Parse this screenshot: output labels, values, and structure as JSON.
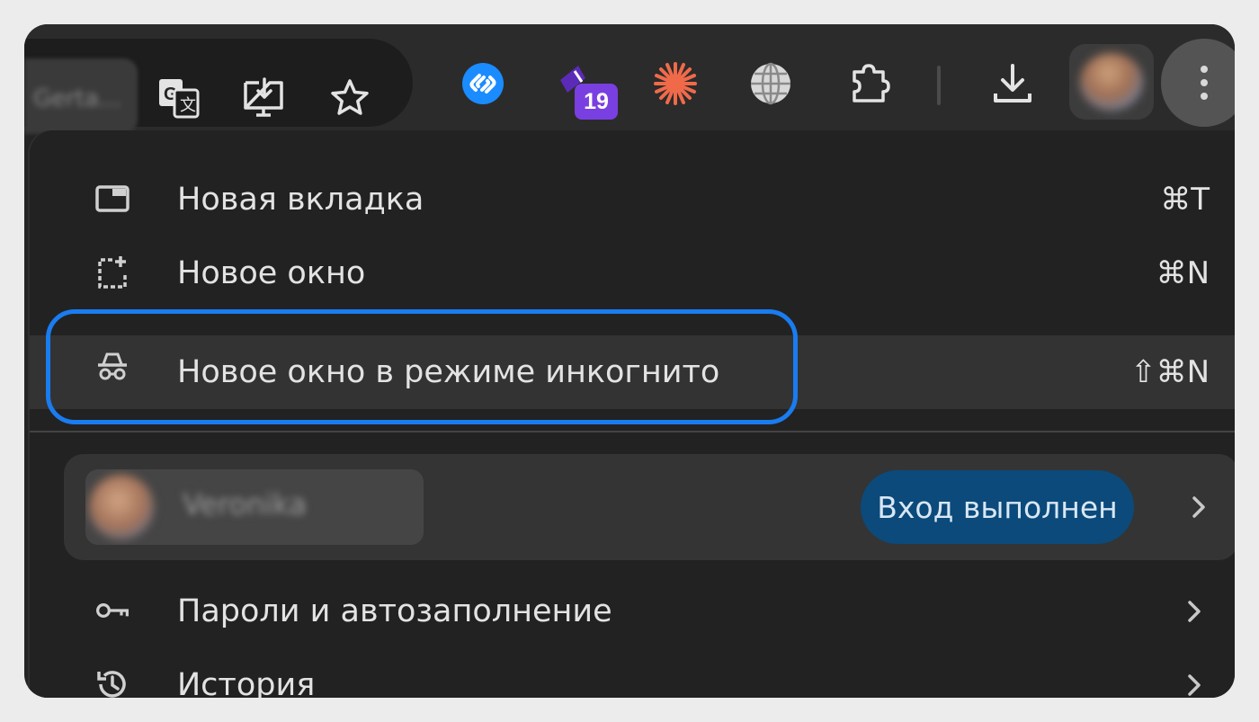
{
  "toolbar": {
    "omnibox_tail_text": "Gerta...",
    "icons": [
      "translate-icon",
      "install-app-icon",
      "bookmark-star-icon",
      "shazam-extension-icon",
      "extension-with-badge-icon",
      "spark-extension-icon",
      "globe-extension-icon",
      "extensions-puzzle-icon",
      "download-icon",
      "profile-avatar",
      "more-menu-icon"
    ],
    "extension_badge": "19"
  },
  "menu": {
    "items": [
      {
        "label": "Новая вкладка",
        "shortcut": "⌘T",
        "icon": "new-tab-icon"
      },
      {
        "label": "Новое окно",
        "shortcut": "⌘N",
        "icon": "new-window-icon"
      },
      {
        "label": "Новое окно в режиме инкогнито",
        "shortcut": "⇧⌘N",
        "icon": "incognito-icon"
      }
    ],
    "profile": {
      "name": "Veronika",
      "status": "Вход выполнен"
    },
    "submenus": [
      {
        "label": "Пароли и автозаполнение",
        "icon": "key-icon"
      },
      {
        "label": "История",
        "icon": "history-icon"
      }
    ]
  },
  "colors": {
    "highlight_ring": "#1a7cf0",
    "signin_pill": "#0b4a7a",
    "menu_bg": "#222222"
  }
}
